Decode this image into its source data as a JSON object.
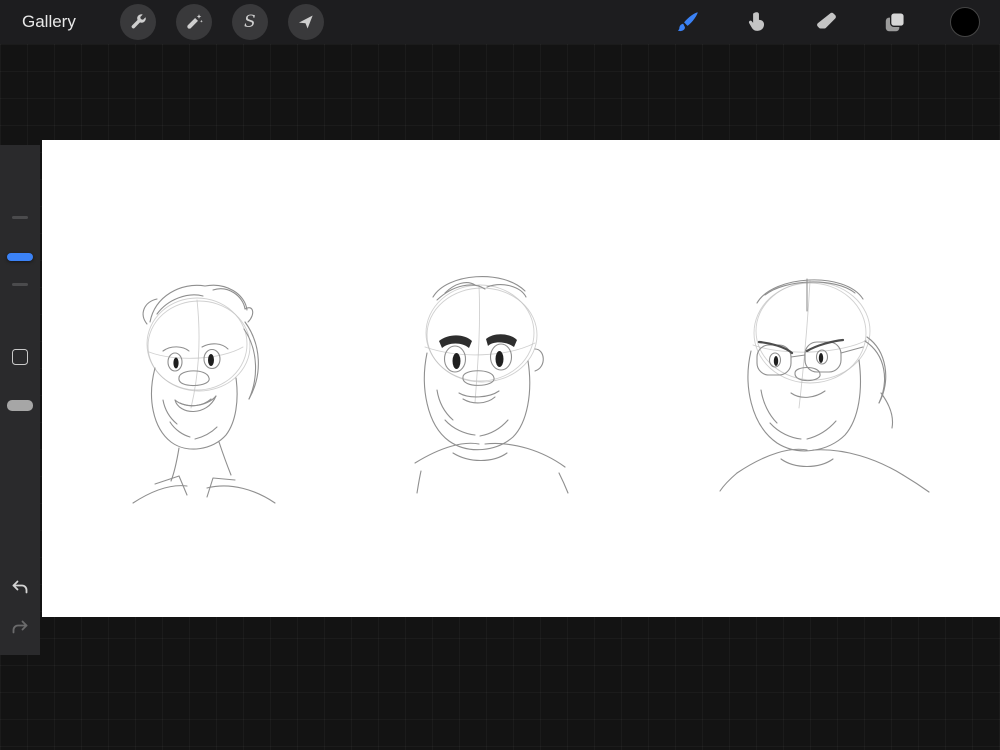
{
  "topbar": {
    "gallery_label": "Gallery",
    "accent_color": "#3b82f6",
    "color_value": "#000000",
    "tools_left": [
      {
        "id": "actions",
        "icon": "wrench-icon"
      },
      {
        "id": "adjustments",
        "icon": "magic-wand-icon"
      },
      {
        "id": "selection",
        "icon": "selection-icon",
        "glyph": "S"
      },
      {
        "id": "transform",
        "icon": "transform-arrow-icon"
      }
    ],
    "tools_right": [
      {
        "id": "paint",
        "icon": "brush-icon",
        "active": true
      },
      {
        "id": "smudge",
        "icon": "smudge-icon",
        "active": false
      },
      {
        "id": "erase",
        "icon": "eraser-icon",
        "active": false
      },
      {
        "id": "layers",
        "icon": "layers-icon",
        "active": false
      },
      {
        "id": "color",
        "icon": "color-swatch",
        "active": false
      }
    ]
  },
  "sidebar": {
    "brush_size_handle_color": "#3b82f6",
    "opacity_handle_color": "#a6a6a6",
    "undo_enabled": true,
    "redo_enabled": false
  },
  "canvas": {
    "background": "#ffffff",
    "content_description": "Three rough graphite sketch studies of a bearded man's head with round nose, large eyes and beard (left: open-mouthed smile; center: thick dark brows; right: wearing glasses, frowning)"
  }
}
